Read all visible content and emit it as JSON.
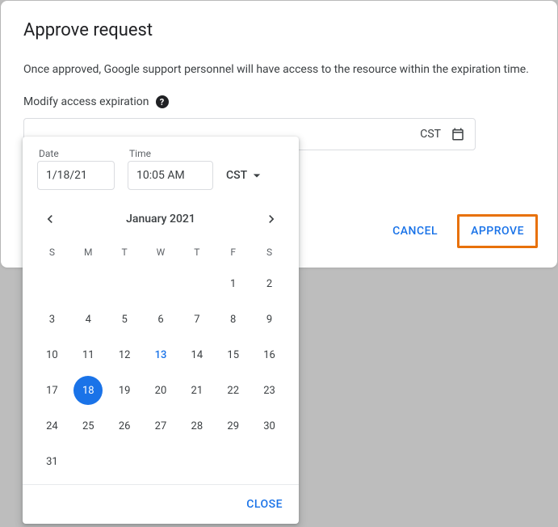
{
  "dialog": {
    "title": "Approve request",
    "description": "Once approved, Google support personnel will have access to the resource within the expiration time.",
    "modify_label": "Modify access expiration",
    "datetime_tz": "CST",
    "cancel": "CANCEL",
    "approve": "APPROVE"
  },
  "picker": {
    "date_label": "Date",
    "date_value": "1/18/21",
    "time_label": "Time",
    "time_value": "10:05 AM",
    "tz": "CST",
    "month": "January 2021",
    "dow": [
      "S",
      "M",
      "T",
      "W",
      "T",
      "F",
      "S"
    ],
    "today": 13,
    "selected": 18,
    "first_weekday": 5,
    "num_days": 31,
    "close": "CLOSE"
  }
}
